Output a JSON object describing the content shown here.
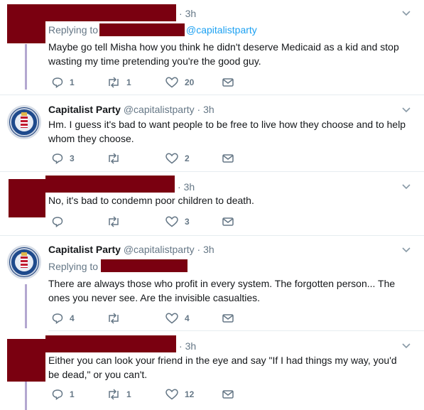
{
  "tweets": [
    {
      "time": "3h",
      "replying_prefix": "Replying to",
      "replying_handle": "@capitalistparty",
      "text": "Maybe go tell Misha how you think he didn't deserve Medicaid as a kid and stop wasting my time pretending you're the good guy.",
      "replies": "1",
      "retweets": "1",
      "likes": "20"
    },
    {
      "name": "Capitalist Party",
      "handle": "@capitalistparty",
      "sep": "·",
      "time": "3h",
      "text": "Hm. I guess it's bad to want people to be free to live how they choose and to help whom they choose.",
      "replies": "3",
      "retweets": "",
      "likes": "2"
    },
    {
      "time": "3h",
      "text": "No, it's bad to condemn poor children to death.",
      "replies": "",
      "retweets": "",
      "likes": "3"
    },
    {
      "name": "Capitalist Party",
      "handle": "@capitalistparty",
      "sep": "·",
      "time": "3h",
      "replying_prefix": "Replying to",
      "text": "There are always those who profit in every system. The forgotten person... The ones you never see. Are the invisible casualties.",
      "replies": "4",
      "retweets": "",
      "likes": "4"
    },
    {
      "time": "3h",
      "text": "Either you can look your friend in the eye and say \"If I had things my way, you'd be dead,\" or you can't.",
      "replies": "1",
      "retweets": "1",
      "likes": "12"
    }
  ],
  "colors": {
    "redaction": "#7a0010",
    "thread_line": "#b3a7d0",
    "link": "#1da1f2",
    "muted": "#657786"
  },
  "icons": [
    "reply-icon",
    "retweet-icon",
    "like-icon",
    "dm-icon",
    "chevron-down-icon",
    "avatar-seal-icon"
  ]
}
